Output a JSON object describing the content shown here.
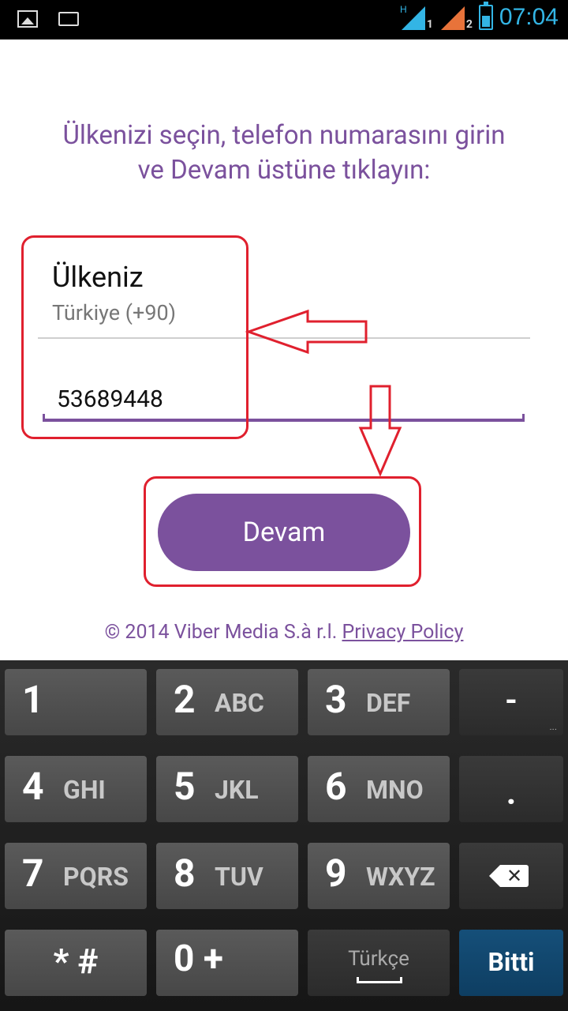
{
  "status_bar": {
    "time": "07:04",
    "sim1_label": "1",
    "sim2_label": "2",
    "network_label": "H",
    "icons": [
      "image-icon",
      "keyboard-icon",
      "signal-icon",
      "signal-icon",
      "battery-icon"
    ]
  },
  "instruction": {
    "line1": "Ülkenizi seçin, telefon numarasını girin",
    "line2": "ve Devam üstüne tıklayın:"
  },
  "country": {
    "label": "Ülkeniz",
    "value": "Türkiye (+90)"
  },
  "phone": {
    "value": "53689448"
  },
  "continue_button": {
    "label": "Devam"
  },
  "footer": {
    "copyright": "© 2014 Viber Media S.à r.l.",
    "privacy_link": "Privacy Policy"
  },
  "keyboard": {
    "keys": [
      {
        "num": "1",
        "letters": ""
      },
      {
        "num": "2",
        "letters": "ABC"
      },
      {
        "num": "3",
        "letters": "DEF"
      },
      {
        "num": "-",
        "letters": ""
      },
      {
        "num": "4",
        "letters": "GHI"
      },
      {
        "num": "5",
        "letters": "JKL"
      },
      {
        "num": "6",
        "letters": "MNO"
      },
      {
        "num": ".",
        "letters": ""
      },
      {
        "num": "7",
        "letters": "PQRS"
      },
      {
        "num": "8",
        "letters": "TUV"
      },
      {
        "num": "9",
        "letters": "WXYZ"
      },
      {
        "num": "",
        "letters": ""
      },
      {
        "num": "* #",
        "letters": ""
      },
      {
        "num": "0 +",
        "letters": ""
      },
      {
        "num": "Türkçe",
        "letters": ""
      },
      {
        "num": "Bitti",
        "letters": ""
      }
    ]
  },
  "colors": {
    "accent": "#7b519d",
    "annotation": "#e0202e",
    "status_time": "#33b5e5",
    "done_key": "#0e3e62"
  }
}
